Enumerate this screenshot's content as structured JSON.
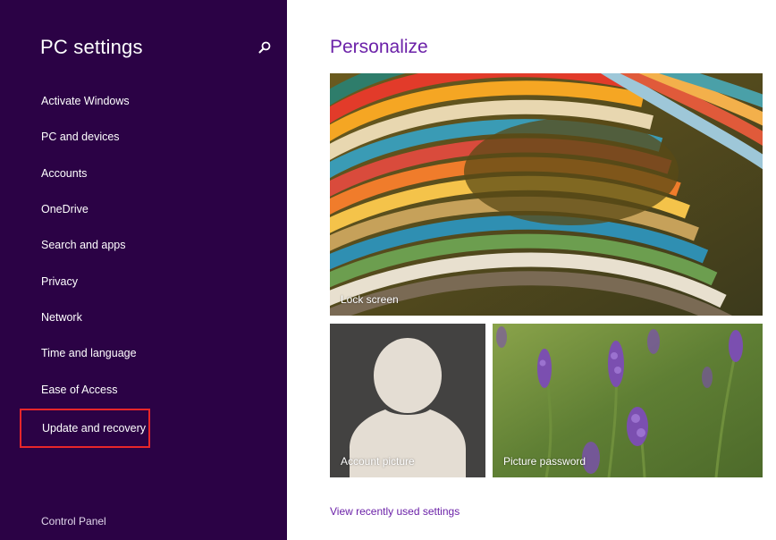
{
  "sidebar": {
    "title": "PC settings",
    "search_icon": "search-icon",
    "items": [
      {
        "label": "Activate Windows"
      },
      {
        "label": "PC and devices"
      },
      {
        "label": "Accounts"
      },
      {
        "label": "OneDrive"
      },
      {
        "label": "Search and apps"
      },
      {
        "label": "Privacy"
      },
      {
        "label": "Network"
      },
      {
        "label": "Time and language"
      },
      {
        "label": "Ease of Access"
      },
      {
        "label": "Update and recovery",
        "highlighted": true
      }
    ],
    "footer_link": "Control Panel",
    "background_color": "#2b0245",
    "highlight_color": "#e8262a"
  },
  "main": {
    "title": "Personalize",
    "title_color": "#6b21a8",
    "tiles": {
      "lock_screen": {
        "label": "Lock screen"
      },
      "account_picture": {
        "label": "Account picture"
      },
      "picture_password": {
        "label": "Picture password"
      }
    },
    "recent_link": "View recently used settings"
  }
}
